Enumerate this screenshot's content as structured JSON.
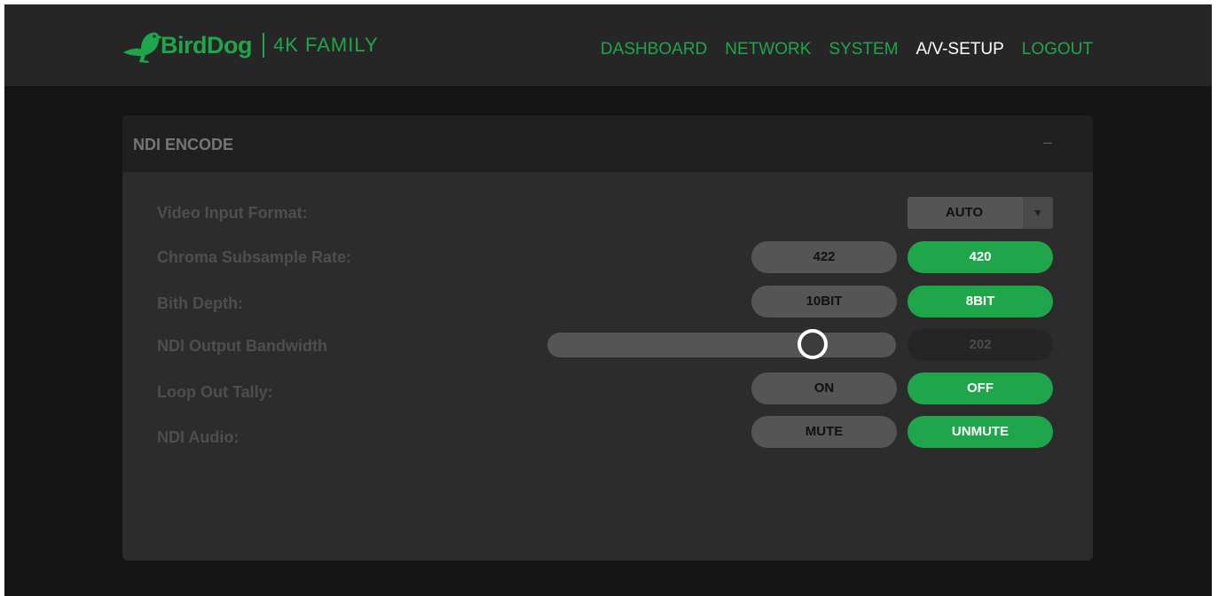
{
  "header": {
    "brand": "BirdDog",
    "product": "4K FAMILY",
    "logo_icon": "bird-icon",
    "nav": [
      {
        "label": "DASHBOARD",
        "active": false
      },
      {
        "label": "NETWORK",
        "active": false
      },
      {
        "label": "SYSTEM",
        "active": false
      },
      {
        "label": "A/V-SETUP",
        "active": true
      },
      {
        "label": "LOGOUT",
        "active": false
      }
    ]
  },
  "panel": {
    "title": "NDI ENCODE",
    "collapse_label": "–",
    "video_input_format": {
      "label": "Video Input Format:",
      "value": "AUTO",
      "arrow": "▼"
    },
    "chroma": {
      "label": "Chroma Subsample Rate:",
      "options": [
        "422",
        "420"
      ],
      "selected": "420"
    },
    "bit_depth": {
      "label": "Bith Depth:",
      "options": [
        "10BIT",
        "8BIT"
      ],
      "selected": "8BIT"
    },
    "bandwidth": {
      "label": "NDI Output Bandwidth",
      "value": "202",
      "fraction": 0.76
    },
    "loop_out_tally": {
      "label": "Loop Out Tally:",
      "options": [
        "ON",
        "OFF"
      ],
      "selected": "OFF"
    },
    "ndi_audio": {
      "label": "NDI Audio:",
      "options": [
        "MUTE",
        "UNMUTE"
      ],
      "selected": "UNMUTE"
    }
  },
  "colors": {
    "accent": "#1fa64a",
    "background": "#151515",
    "panel": "#2c2c2c",
    "button_inactive": "#555555"
  }
}
